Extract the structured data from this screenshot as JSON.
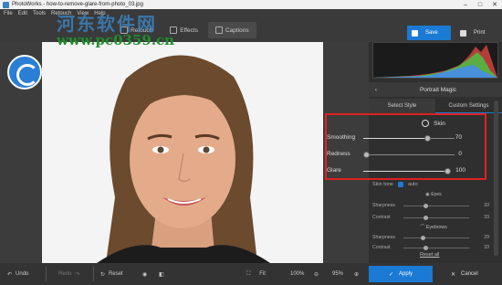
{
  "window": {
    "title": "PhotoWorks - how-to-remove-glare-from-photo_03.jpg"
  },
  "menu": [
    "File",
    "Edit",
    "Tools",
    "Retouch",
    "View",
    "Help"
  ],
  "toolbar": {
    "tools": [
      "Retouch",
      "Effects",
      "Captions"
    ]
  },
  "actions": {
    "save": "Save",
    "print": "Print"
  },
  "watermark": {
    "line1": "河东软件网",
    "line2": "www.pc0359.cn"
  },
  "panel": {
    "title": "Portrait Magic",
    "tabs": [
      {
        "label": "Select Style"
      },
      {
        "label": "Custom Settings",
        "active": true
      }
    ],
    "skin": {
      "section_label": "Skin",
      "sliders": [
        {
          "label": "Smoothing",
          "value": 70
        },
        {
          "label": "Redness",
          "value": 0
        },
        {
          "label": "Glare",
          "value": 100
        }
      ],
      "skin_tone_label": "Skin tone",
      "skin_tone_option": "auto"
    },
    "eyes": {
      "label": "Eyes",
      "sliders": [
        {
          "label": "Sharpness",
          "value": 33
        },
        {
          "label": "Contrast",
          "value": 33
        }
      ]
    },
    "eyebrows": {
      "label": "Eyebrows",
      "sliders": [
        {
          "label": "Sharpness",
          "value": 29
        },
        {
          "label": "Contrast",
          "value": 33
        }
      ]
    },
    "reset_all": "Reset all"
  },
  "bottom": {
    "undo": "Undo",
    "redo": "Redo",
    "reset": "Reset",
    "fit": "Fit",
    "zoom_100": "100%",
    "zoom_current": "95%",
    "apply": "Apply",
    "cancel": "Cancel"
  },
  "colors": {
    "accent": "#1a7ad4",
    "highlight": "#e02020"
  }
}
